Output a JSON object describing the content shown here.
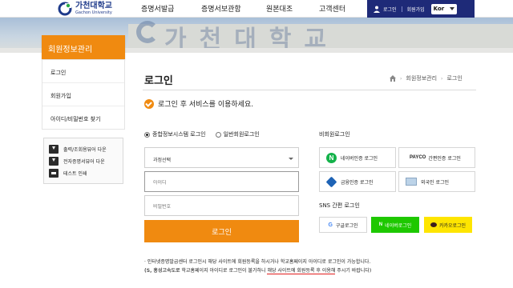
{
  "header": {
    "logo_ko": "가천대학교",
    "logo_en": "Gachon University",
    "nav": [
      "증명서발급",
      "증명서보관함",
      "원본대조",
      "고객센터"
    ],
    "login": "로그인",
    "signup": "회원가입",
    "lang": "Kor"
  },
  "banner": {
    "sign": "가천대학교"
  },
  "sidebar": {
    "title": "회원정보관리",
    "items": [
      "로그인",
      "회원가입",
      "아이디/비밀번호 찾기"
    ],
    "quick": [
      "출력/조회용뷰어 다운",
      "전자증명서뷰어 다운",
      "테스트 인쇄"
    ]
  },
  "main": {
    "title": "로그인",
    "breadcrumb": [
      "회원정보관리",
      "로그인"
    ],
    "notice": "로그인 후 서비스를 이용하세요.",
    "radio_integrated": "종합정보시스템 로그인",
    "radio_general": "일반회원로그인",
    "select_value": "과정선택",
    "id_placeholder": "아이디",
    "pw_placeholder": "비밀번호",
    "login_button": "로그인",
    "nonmember_label": "비회원로그인",
    "ext": [
      "네이버인증 로그인",
      "간편인증 로그인",
      "금융인증 로그인",
      "외국인 로그인"
    ],
    "payco": "PAYCO",
    "sns_label": "SNS 간편 로그인",
    "sns": [
      "구글로그인",
      "네이버로그인",
      "카카오로그인"
    ],
    "info1": "· 인터넷증명발급센터 로그인시 해당 사이트에 회원등록을 하시거나 학교홈페이지 아이디로 로그인이 가능합니다.",
    "info2_prefix": "(S, 홍성고속도로",
    "info2_mid": " 학교홈페이지 아이디로 로그인이 불가하니 ",
    "info2_under": "해당 사이트에 회원등록 후 이용해",
    "info2_suffix": " 주시기 바랍니다)"
  },
  "colors": {
    "accent": "#f08a10",
    "navy": "#1e2a78",
    "naver": "#1ec800",
    "kakao": "#fee500"
  }
}
